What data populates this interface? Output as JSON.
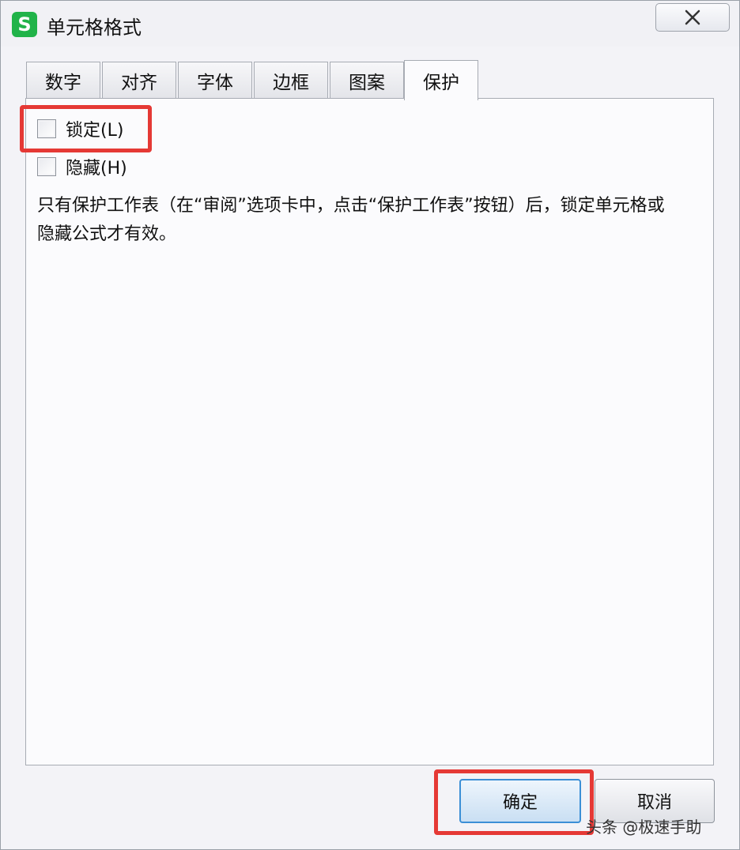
{
  "window": {
    "title": "单元格格式",
    "app_icon_glyph": "S",
    "close_glyph": "✕"
  },
  "tabs": [
    {
      "label": "数字",
      "active": false
    },
    {
      "label": "对齐",
      "active": false
    },
    {
      "label": "字体",
      "active": false
    },
    {
      "label": "边框",
      "active": false
    },
    {
      "label": "图案",
      "active": false
    },
    {
      "label": "保护",
      "active": true
    }
  ],
  "protection": {
    "locked": {
      "label": "锁定(L)",
      "checked": false
    },
    "hidden": {
      "label": "隐藏(H)",
      "checked": false
    },
    "description": "只有保护工作表（在“审阅”选项卡中，点击“保护工作表”按钮）后，锁定单元格或隐藏公式才有效。"
  },
  "buttons": {
    "ok": "确定",
    "cancel": "取消"
  },
  "watermark": "头条 @极速手助",
  "colors": {
    "highlight": "#e53935",
    "app_icon": "#21b349",
    "primary_border": "#3b8fd6"
  }
}
